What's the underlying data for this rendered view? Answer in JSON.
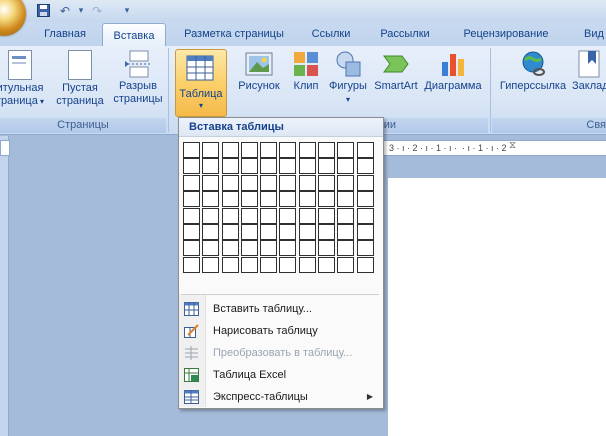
{
  "tabs": [
    "Главная",
    "Вставка",
    "Разметка страницы",
    "Ссылки",
    "Рассылки",
    "Рецензирование",
    "Вид"
  ],
  "active_tab": "Вставка",
  "ribbon": {
    "pages_group": {
      "caption": "Страницы",
      "title_page": {
        "line1": "итульная",
        "line2": "траница"
      },
      "blank_page": {
        "line1": "Пустая",
        "line2": "страница"
      },
      "page_break": {
        "line1": "Разрыв",
        "line2": "страницы"
      }
    },
    "table_button": {
      "label": "Таблица"
    },
    "illustrations": {
      "picture": "Рисунок",
      "clip": "Клип",
      "shapes": "Фигуры",
      "smartart": "SmartArt",
      "chart": "Диаграмма",
      "caption_fragment": "ии"
    },
    "links": {
      "hyperlink": "Гиперссылка",
      "bookmark": "Заклад",
      "caption_fragment": "Свя"
    }
  },
  "ruler": {
    "marks": "3 · ı · 2 · ı · 1 · ı ·  · ı · 1 · ı · 2"
  },
  "dropdown": {
    "title": "Вставка таблицы",
    "grid": {
      "columns": 10,
      "rows": 8
    },
    "items": [
      {
        "label": "Вставить таблицу...",
        "icon": "insert-table-icon",
        "enabled": true
      },
      {
        "label": "Нарисовать таблицу",
        "icon": "draw-table-icon",
        "enabled": true
      },
      {
        "label": "Преобразовать в таблицу...",
        "icon": "convert-to-table-icon",
        "enabled": false
      },
      {
        "label": "Таблица Excel",
        "icon": "excel-table-icon",
        "enabled": true
      },
      {
        "label": "Экспресс-таблицы",
        "icon": "quick-tables-icon",
        "enabled": true,
        "submenu": true
      }
    ]
  }
}
